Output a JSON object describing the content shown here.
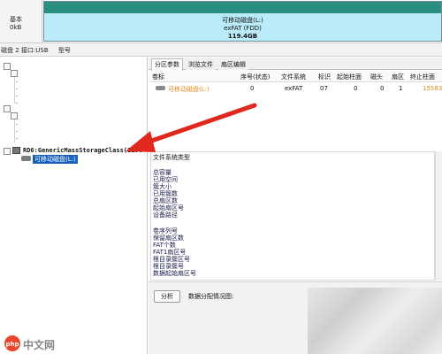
{
  "disk_map": {
    "disk_label_line1": "基本",
    "disk_label_line2": "0&#8203;kB",
    "partition_name": "可移动磁盘(L:)",
    "partition_fs": "exFAT (FDD)",
    "partition_size": "119.4GB"
  },
  "info_strip": {
    "disk_info": "磁盘 2 接口:USB",
    "model_label": "型号"
  },
  "tree": {
    "device_label": "RD6:GenericMassStorageClass(119G",
    "partition_label": "可移动磁盘(L:)"
  },
  "tabs": [
    "分区参数",
    "浏览文件",
    "扇区编辑"
  ],
  "table": {
    "headers": [
      "卷标",
      "序号(状态)",
      "文件系统",
      "标识",
      "起始柱面",
      "磁头",
      "扇区",
      "终止柱面"
    ],
    "row": [
      "可移动磁盘(L:)",
      "0",
      "exFAT",
      "07",
      "0",
      "0",
      "1",
      "15583"
    ]
  },
  "fs_info": {
    "title": "文件系统类型",
    "fields_1": [
      "总容量",
      "已用空间",
      "簇大小",
      "已用簇数",
      "总扇区数",
      "起始扇区号",
      "设备路径"
    ],
    "fields_2": [
      "卷序列号",
      "保留扇区数",
      "FAT个数",
      "FAT1扇区号",
      "根目录簇区号",
      "根目录簇号",
      "数据起始扇区号"
    ]
  },
  "bottom": {
    "analyze_button": "分析",
    "caption": "数据分配情况图:"
  },
  "watermark": {
    "text": "中文网"
  },
  "colors": {
    "partition_fill": "#b9ecf8",
    "partition_stripe": "#2a8f7e",
    "arrow": "#e0281c",
    "device_highlight": "#1560bd",
    "partition_row_text": "#e08a1e"
  }
}
